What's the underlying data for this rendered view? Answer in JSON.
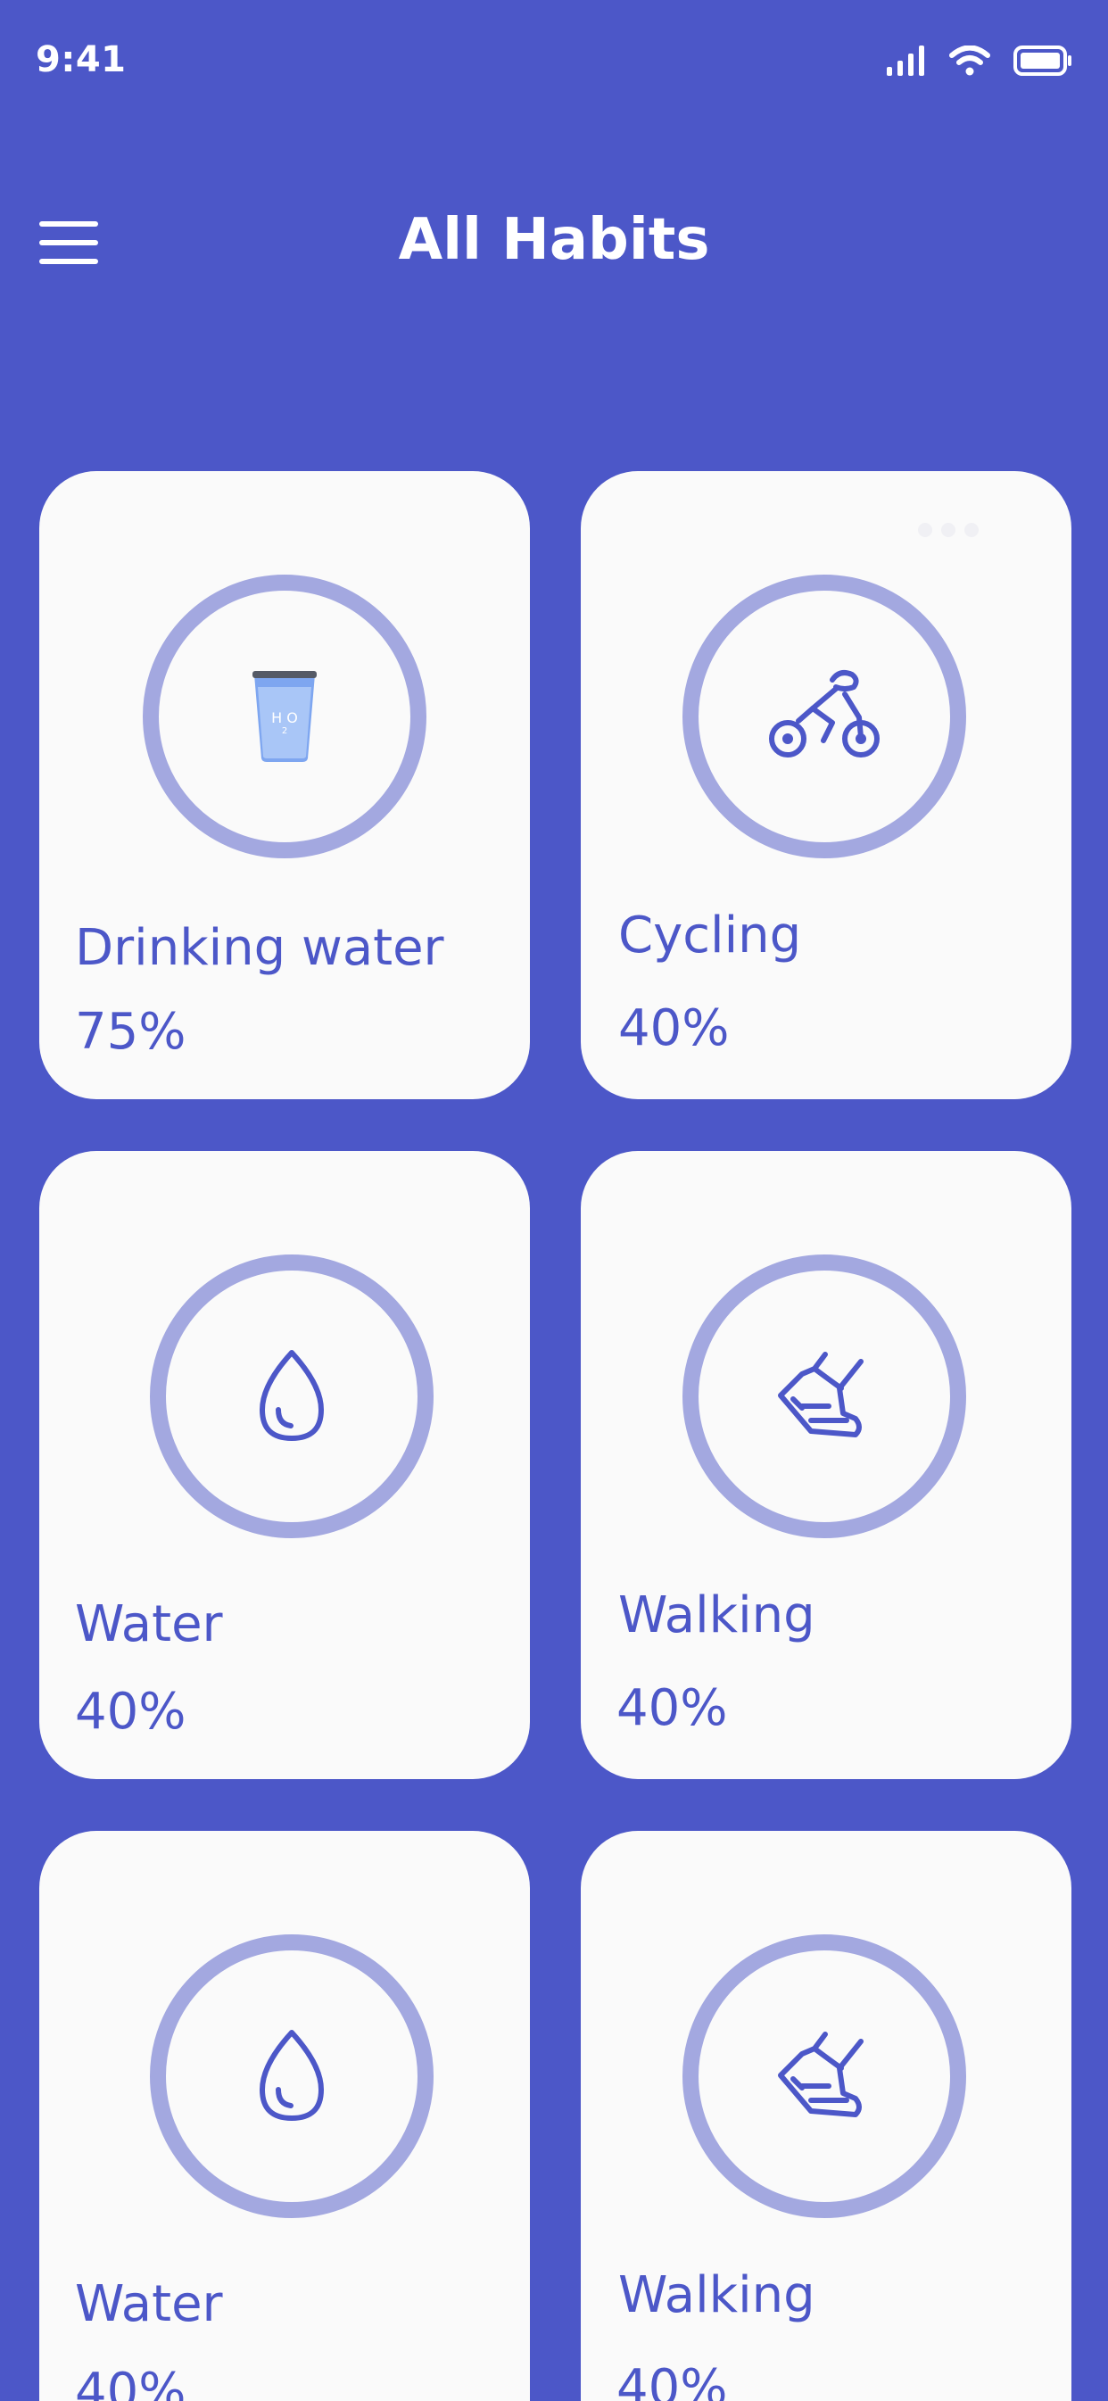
{
  "status_bar": {
    "time": "9:41"
  },
  "header": {
    "title": "All Habits"
  },
  "habits": [
    {
      "name": "Drinking water",
      "percent": "75%",
      "icon": "water-glass-icon"
    },
    {
      "name": "Cycling",
      "percent": "40%",
      "icon": "cyclist-icon"
    },
    {
      "name": "Water",
      "percent": "40%",
      "icon": "water-drop-icon"
    },
    {
      "name": "Walking",
      "percent": "40%",
      "icon": "walking-shoe-icon"
    },
    {
      "name": "Water",
      "percent": "40%",
      "icon": "water-drop-icon"
    },
    {
      "name": "Walking",
      "percent": "40%",
      "icon": "walking-shoe-icon"
    }
  ],
  "colors": {
    "background": "#4C57C8",
    "card": "#FAFAFA",
    "ring": "#A3A8E0",
    "accent_text": "#4C57C8"
  }
}
